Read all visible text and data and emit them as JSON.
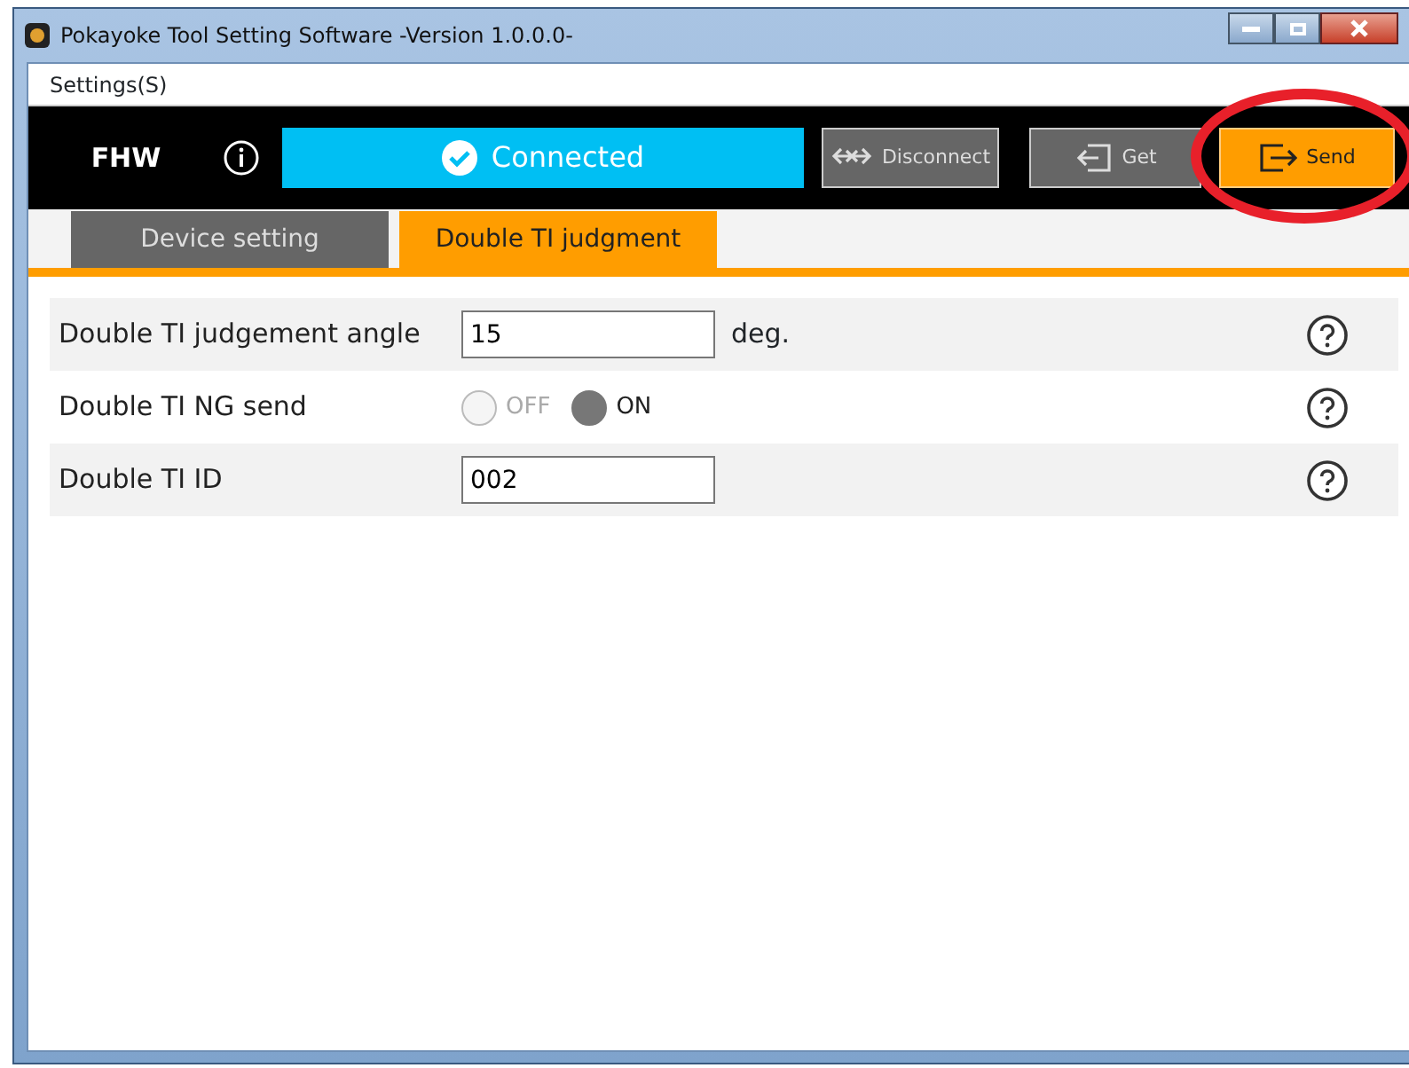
{
  "window": {
    "title": "Pokayoke Tool Setting Software -Version 1.0.0.0-"
  },
  "menu": [
    {
      "label": "Settings(S)"
    }
  ],
  "toolbar": {
    "device": "FHW",
    "status": {
      "label": "Connected",
      "connected": true
    },
    "buttons": [
      {
        "label": "Disconnect",
        "kind": "disconnect",
        "primary": false,
        "circled": false
      },
      {
        "label": "Get",
        "kind": "get",
        "primary": false,
        "circled": false
      },
      {
        "label": "Send",
        "kind": "send",
        "primary": true,
        "circled": true
      }
    ]
  },
  "tabs": [
    {
      "label": "Device setting",
      "selected": false
    },
    {
      "label": "Double TI judgment",
      "selected": true
    }
  ],
  "settings": [
    {
      "kind": "text",
      "label": "Double TI judgement angle",
      "value": "15",
      "unit": "deg."
    },
    {
      "kind": "radio",
      "label": "Double TI NG send",
      "options": [
        {
          "label": "OFF",
          "selected": false
        },
        {
          "label": "ON",
          "selected": true
        }
      ]
    },
    {
      "kind": "text",
      "label": "Double TI ID",
      "value": "002"
    }
  ]
}
